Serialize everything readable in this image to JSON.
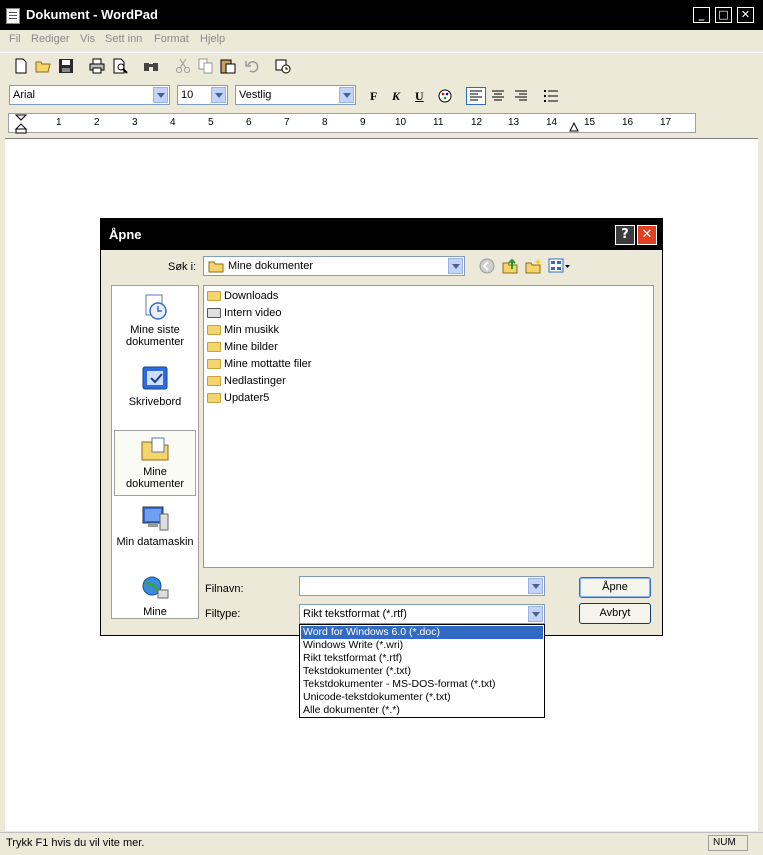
{
  "window": {
    "title": "Dokument - WordPad",
    "controls": {
      "minimize": "_",
      "maximize": "□",
      "close": "✕"
    }
  },
  "menu": [
    "Fil",
    "Rediger",
    "Vis",
    "Sett inn",
    "Format",
    "Hjelp"
  ],
  "format_bar": {
    "font": "Arial",
    "size": "10",
    "script": "Vestlig",
    "bold": "F",
    "italic": "K",
    "underline": "U"
  },
  "ruler": {
    "numbers": [
      "1",
      "2",
      "3",
      "4",
      "5",
      "6",
      "7",
      "8",
      "9",
      "10",
      "11",
      "12",
      "13",
      "14",
      "15",
      "16",
      "17"
    ]
  },
  "status": {
    "text": "Trykk F1 hvis du vil vite mer.",
    "num": "NUM"
  },
  "dialog": {
    "title": "Åpne",
    "help": "?",
    "close": "✕",
    "look_in_label": "Søk i:",
    "look_in_value": "Mine dokumenter",
    "places": [
      {
        "label": "Mine siste dokumenter",
        "icon": "recent-documents-icon"
      },
      {
        "label": "Skrivebord",
        "icon": "desktop-icon"
      },
      {
        "label": "Mine dokumenter",
        "icon": "my-documents-icon"
      },
      {
        "label": "Min datamaskin",
        "icon": "my-computer-icon"
      },
      {
        "label": "Mine",
        "icon": "network-places-icon"
      }
    ],
    "files": [
      "Downloads",
      "Intern video",
      "Min musikk",
      "Mine bilder",
      "Mine mottatte filer",
      "Nedlastinger",
      "Updater5"
    ],
    "filename_label": "Filnavn:",
    "filename_value": "",
    "filetype_label": "Filtype:",
    "filetype_value": "Rikt tekstformat (*.rtf)",
    "open_button": "Åpne",
    "cancel_button": "Avbryt",
    "filetype_options": [
      "Word for Windows 6.0 (*.doc)",
      "Windows Write (*.wri)",
      "Rikt tekstformat (*.rtf)",
      "Tekstdokumenter (*.txt)",
      "Tekstdokumenter - MS-DOS-format (*.txt)",
      "Unicode-tekstdokumenter (*.txt)",
      "Alle dokumenter (*.*)"
    ],
    "selected_option_index": 0
  },
  "colors": {
    "selection": "#316ac5",
    "dialog_bg": "#ece9d8",
    "close": "#e1411f"
  }
}
